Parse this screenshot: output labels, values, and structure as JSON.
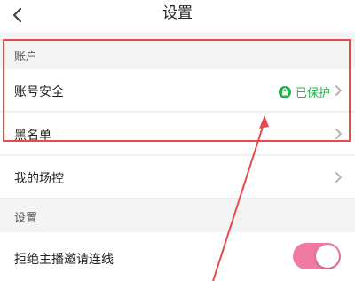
{
  "nav": {
    "title": "设置"
  },
  "sections": {
    "account_header": "账户",
    "settings_header": "设置"
  },
  "rows": {
    "account_security": {
      "label": "账号安全",
      "status": "已保护"
    },
    "blacklist": {
      "label": "黑名单"
    },
    "my_moderators": {
      "label": "我的场控"
    },
    "reject_invite": {
      "label": "拒绝主播邀请连线",
      "toggle_on": true
    }
  },
  "colors": {
    "protected_green": "#22b14c",
    "toggle_pink": "#f07ba0",
    "annotation_red": "#e8494c",
    "chevron_gray": "#b5b5b5"
  },
  "icons": {
    "back": "chevron-left-icon",
    "lock": "lock-icon",
    "chevron": "chevron-right-icon"
  }
}
